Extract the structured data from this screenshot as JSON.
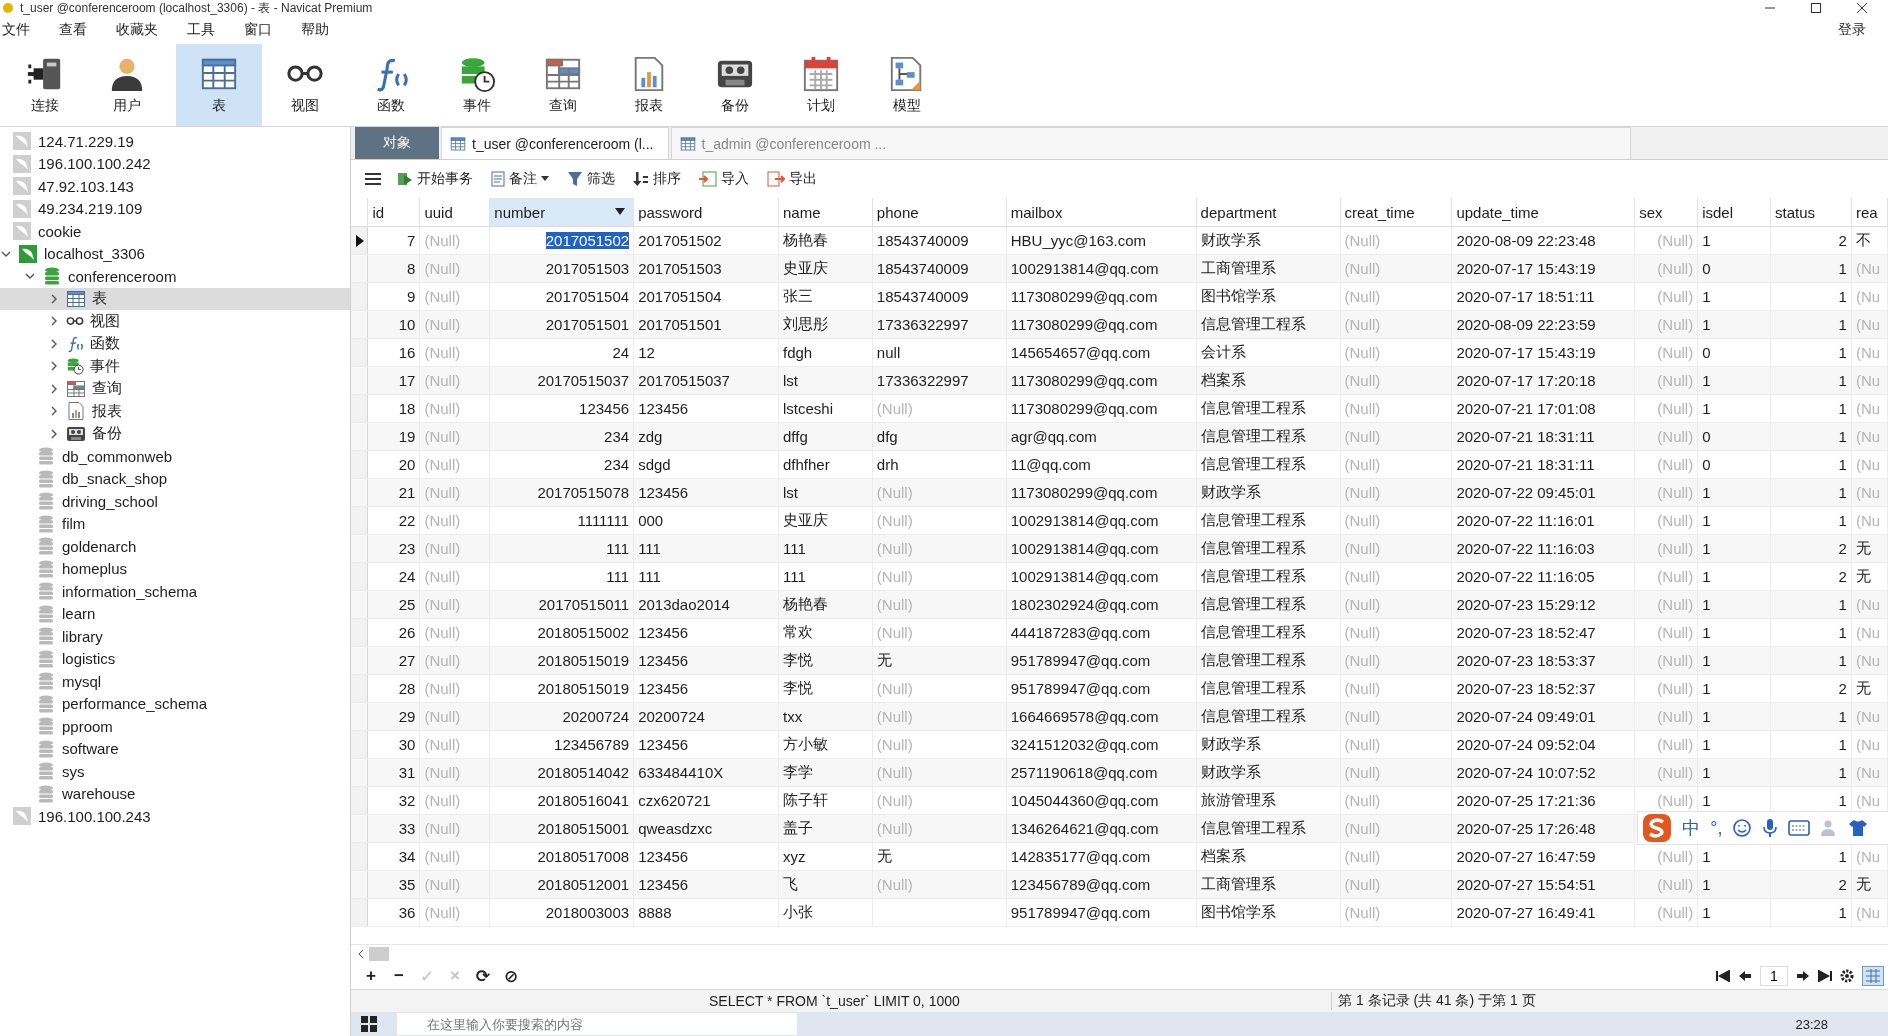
{
  "window": {
    "title": "t_user @conferenceroom (localhost_3306) - 表 - Navicat Premium"
  },
  "menu": [
    "文件",
    "查看",
    "收藏夹",
    "工具",
    "窗口",
    "帮助"
  ],
  "login": "登录",
  "toolbar": [
    {
      "label": "连接",
      "kind": "connection",
      "selected": false
    },
    {
      "label": "用户",
      "kind": "user",
      "selected": false
    },
    {
      "label": "表",
      "kind": "tables",
      "selected": true
    },
    {
      "label": "视图",
      "kind": "views",
      "selected": false
    },
    {
      "label": "函数",
      "kind": "functions",
      "selected": false
    },
    {
      "label": "事件",
      "kind": "events",
      "selected": false
    },
    {
      "label": "查询",
      "kind": "queries",
      "selected": false
    },
    {
      "label": "报表",
      "kind": "reports",
      "selected": false
    },
    {
      "label": "备份",
      "kind": "backups",
      "selected": false
    },
    {
      "label": "计划",
      "kind": "schedule",
      "selected": false
    },
    {
      "label": "模型",
      "kind": "model",
      "selected": false
    }
  ],
  "sidebar": {
    "tree": [
      {
        "label": "124.71.229.19",
        "kind": "connection",
        "active": false
      },
      {
        "label": "196.100.100.242",
        "kind": "connection",
        "active": false
      },
      {
        "label": "47.92.103.143",
        "kind": "connection",
        "active": false
      },
      {
        "label": "49.234.219.109",
        "kind": "connection",
        "active": false
      },
      {
        "label": "cookie",
        "kind": "connection",
        "active": false
      },
      {
        "label": "localhost_3306",
        "kind": "connection",
        "active": true,
        "expanded": true,
        "children": [
          {
            "label": "conferenceroom",
            "kind": "database",
            "active": true,
            "expanded": true,
            "children": [
              {
                "label": "表",
                "kind": "tables",
                "selected": true,
                "expanded": false
              },
              {
                "label": "视图",
                "kind": "views",
                "selected": false,
                "expanded": false
              },
              {
                "label": "函数",
                "kind": "functions",
                "selected": false,
                "expanded": false
              },
              {
                "label": "事件",
                "kind": "events",
                "selected": false,
                "expanded": false
              },
              {
                "label": "查询",
                "kind": "queries",
                "selected": false,
                "expanded": false
              },
              {
                "label": "报表",
                "kind": "reports",
                "selected": false,
                "expanded": false
              },
              {
                "label": "备份",
                "kind": "backups",
                "selected": false,
                "expanded": false
              }
            ]
          },
          {
            "label": "db_commonweb",
            "kind": "database",
            "active": false
          },
          {
            "label": "db_snack_shop",
            "kind": "database",
            "active": false
          },
          {
            "label": "driving_school",
            "kind": "database",
            "active": false
          },
          {
            "label": "film",
            "kind": "database",
            "active": false
          },
          {
            "label": "goldenarch",
            "kind": "database",
            "active": false
          },
          {
            "label": "homeplus",
            "kind": "database",
            "active": false
          },
          {
            "label": "information_schema",
            "kind": "database",
            "active": false
          },
          {
            "label": "learn",
            "kind": "database",
            "active": false
          },
          {
            "label": "library",
            "kind": "database",
            "active": false
          },
          {
            "label": "logistics",
            "kind": "database",
            "active": false
          },
          {
            "label": "mysql",
            "kind": "database",
            "active": false
          },
          {
            "label": "performance_schema",
            "kind": "database",
            "active": false
          },
          {
            "label": "pproom",
            "kind": "database",
            "active": false
          },
          {
            "label": "software",
            "kind": "database",
            "active": false
          },
          {
            "label": "sys",
            "kind": "database",
            "active": false
          },
          {
            "label": "warehouse",
            "kind": "database",
            "active": false
          }
        ]
      },
      {
        "label": "196.100.100.243",
        "kind": "connection",
        "active": false
      }
    ]
  },
  "tabs": [
    {
      "label": "对象",
      "kind": "objects",
      "selected": false
    },
    {
      "label": "t_user @conferenceroom (l...",
      "kind": "table",
      "selected": true
    },
    {
      "label": "t_admin @conferenceroom ...",
      "kind": "table",
      "selected": false
    }
  ],
  "actions": [
    {
      "label": "开始事务",
      "kind": "transaction"
    },
    {
      "label": "备注",
      "kind": "memo"
    },
    {
      "label": "筛选",
      "kind": "filter"
    },
    {
      "label": "排序",
      "kind": "sort"
    },
    {
      "label": "导入",
      "kind": "import"
    },
    {
      "label": "导出",
      "kind": "export"
    }
  ],
  "table": {
    "columns": [
      {
        "name": "id",
        "kind": "number",
        "selected": false
      },
      {
        "name": "uuid",
        "kind": "text",
        "selected": false
      },
      {
        "name": "number",
        "kind": "number",
        "selected": true
      },
      {
        "name": "password",
        "kind": "text",
        "selected": false
      },
      {
        "name": "name",
        "kind": "text",
        "selected": false
      },
      {
        "name": "phone",
        "kind": "text",
        "selected": false
      },
      {
        "name": "mailbox",
        "kind": "text",
        "selected": false
      },
      {
        "name": "department",
        "kind": "text",
        "selected": false
      },
      {
        "name": "creat_time",
        "kind": "text",
        "selected": false
      },
      {
        "name": "update_time",
        "kind": "text",
        "selected": false
      },
      {
        "name": "sex",
        "kind": "number",
        "selected": false
      },
      {
        "name": "isdel",
        "kind": "text",
        "selected": false
      },
      {
        "name": "status",
        "kind": "number",
        "selected": false
      },
      {
        "name": "rea",
        "kind": "text",
        "selected": false
      }
    ],
    "rows": [
      {
        "current": true,
        "cells": [
          "7",
          {
            "null": "(Null)"
          },
          "2017051502",
          "2017051502",
          "杨艳春",
          "18543740009",
          "HBU_yyc@163.com",
          "财政学系",
          {
            "null": "(Null)"
          },
          "2020-08-09 22:23:48",
          {
            "null": "(Null)"
          },
          "1",
          "2",
          "不"
        ]
      },
      {
        "current": false,
        "cells": [
          "8",
          {
            "null": "(Null)"
          },
          "2017051503",
          "2017051503",
          "史亚庆",
          "18543740009",
          "1002913814@qq.com",
          "工商管理系",
          {
            "null": "(Null)"
          },
          "2020-07-17 15:43:19",
          {
            "null": "(Null)"
          },
          "0",
          "1",
          {
            "null": "(Nu"
          }
        ]
      },
      {
        "current": false,
        "cells": [
          "9",
          {
            "null": "(Null)"
          },
          "2017051504",
          "2017051504",
          "张三",
          "18543740009",
          "1173080299@qq.com",
          "图书馆学系",
          {
            "null": "(Null)"
          },
          "2020-07-17 18:51:11",
          {
            "null": "(Null)"
          },
          "1",
          "1",
          {
            "null": "(Nu"
          }
        ]
      },
      {
        "current": false,
        "cells": [
          "10",
          {
            "null": "(Null)"
          },
          "2017051501",
          "2017051501",
          "刘思彤",
          "17336322997",
          "1173080299@qq.com",
          "信息管理工程系",
          {
            "null": "(Null)"
          },
          "2020-08-09 22:23:59",
          {
            "null": "(Null)"
          },
          "1",
          "1",
          {
            "null": "(Nu"
          }
        ]
      },
      {
        "current": false,
        "cells": [
          "16",
          {
            "null": "(Null)"
          },
          "24",
          "12",
          "fdgh",
          "null",
          "145654657@qq.com",
          "会计系",
          {
            "null": "(Null)"
          },
          "2020-07-17 15:43:19",
          {
            "null": "(Null)"
          },
          "0",
          "1",
          {
            "null": "(Nu"
          }
        ]
      },
      {
        "current": false,
        "cells": [
          "17",
          {
            "null": "(Null)"
          },
          "20170515037",
          "20170515037",
          "lst",
          "17336322997",
          "1173080299@qq.com",
          "档案系",
          {
            "null": "(Null)"
          },
          "2020-07-17 17:20:18",
          {
            "null": "(Null)"
          },
          "1",
          "1",
          {
            "null": "(Nu"
          }
        ]
      },
      {
        "current": false,
        "cells": [
          "18",
          {
            "null": "(Null)"
          },
          "123456",
          "123456",
          "lstceshi",
          {
            "null": "(Null)"
          },
          "1173080299@qq.com",
          "信息管理工程系",
          {
            "null": "(Null)"
          },
          "2020-07-21 17:01:08",
          {
            "null": "(Null)"
          },
          "1",
          "1",
          {
            "null": "(Nu"
          }
        ]
      },
      {
        "current": false,
        "cells": [
          "19",
          {
            "null": "(Null)"
          },
          "234",
          "zdg",
          "dffg",
          "dfg",
          "agr@qq.com",
          "信息管理工程系",
          {
            "null": "(Null)"
          },
          "2020-07-21 18:31:11",
          {
            "null": "(Null)"
          },
          "0",
          "1",
          {
            "null": "(Nu"
          }
        ]
      },
      {
        "current": false,
        "cells": [
          "20",
          {
            "null": "(Null)"
          },
          "234",
          "sdgd",
          "dfhfher",
          "drh",
          "11@qq.com",
          "信息管理工程系",
          {
            "null": "(Null)"
          },
          "2020-07-21 18:31:11",
          {
            "null": "(Null)"
          },
          "0",
          "1",
          {
            "null": "(Nu"
          }
        ]
      },
      {
        "current": false,
        "cells": [
          "21",
          {
            "null": "(Null)"
          },
          "20170515078",
          "123456",
          "lst",
          {
            "null": "(Null)"
          },
          "1173080299@qq.com",
          "财政学系",
          {
            "null": "(Null)"
          },
          "2020-07-22 09:45:01",
          {
            "null": "(Null)"
          },
          "1",
          "1",
          {
            "null": "(Nu"
          }
        ]
      },
      {
        "current": false,
        "cells": [
          "22",
          {
            "null": "(Null)"
          },
          "1111111",
          "000",
          "史亚庆",
          {
            "null": "(Null)"
          },
          "1002913814@qq.com",
          "信息管理工程系",
          {
            "null": "(Null)"
          },
          "2020-07-22 11:16:01",
          {
            "null": "(Null)"
          },
          "1",
          "1",
          {
            "null": "(Nu"
          }
        ]
      },
      {
        "current": false,
        "cells": [
          "23",
          {
            "null": "(Null)"
          },
          "111",
          "111",
          "111",
          {
            "null": "(Null)"
          },
          "1002913814@qq.com",
          "信息管理工程系",
          {
            "null": "(Null)"
          },
          "2020-07-22 11:16:03",
          {
            "null": "(Null)"
          },
          "1",
          "2",
          "无"
        ]
      },
      {
        "current": false,
        "cells": [
          "24",
          {
            "null": "(Null)"
          },
          "111",
          "111",
          "111",
          {
            "null": "(Null)"
          },
          "1002913814@qq.com",
          "信息管理工程系",
          {
            "null": "(Null)"
          },
          "2020-07-22 11:16:05",
          {
            "null": "(Null)"
          },
          "1",
          "2",
          "无"
        ]
      },
      {
        "current": false,
        "cells": [
          "25",
          {
            "null": "(Null)"
          },
          "20170515011",
          "2013dao2014",
          "杨艳春",
          {
            "null": "(Null)"
          },
          "1802302924@qq.com",
          "信息管理工程系",
          {
            "null": "(Null)"
          },
          "2020-07-23 15:29:12",
          {
            "null": "(Null)"
          },
          "1",
          "1",
          {
            "null": "(Nu"
          }
        ]
      },
      {
        "current": false,
        "cells": [
          "26",
          {
            "null": "(Null)"
          },
          "20180515002",
          "123456",
          "常欢",
          {
            "null": "(Null)"
          },
          "444187283@qq.com",
          "信息管理工程系",
          {
            "null": "(Null)"
          },
          "2020-07-23 18:52:47",
          {
            "null": "(Null)"
          },
          "1",
          "1",
          {
            "null": "(Nu"
          }
        ]
      },
      {
        "current": false,
        "cells": [
          "27",
          {
            "null": "(Null)"
          },
          "20180515019",
          "123456",
          "李悦",
          "无",
          "951789947@qq.com",
          "信息管理工程系",
          {
            "null": "(Null)"
          },
          "2020-07-23 18:53:37",
          {
            "null": "(Null)"
          },
          "1",
          "1",
          {
            "null": "(Nu"
          }
        ]
      },
      {
        "current": false,
        "cells": [
          "28",
          {
            "null": "(Null)"
          },
          "20180515019",
          "123456",
          "李悦",
          {
            "null": "(Null)"
          },
          "951789947@qq.com",
          "信息管理工程系",
          {
            "null": "(Null)"
          },
          "2020-07-23 18:52:37",
          {
            "null": "(Null)"
          },
          "1",
          "2",
          "无"
        ]
      },
      {
        "current": false,
        "cells": [
          "29",
          {
            "null": "(Null)"
          },
          "20200724",
          "20200724",
          "txx",
          {
            "null": "(Null)"
          },
          "1664669578@qq.com",
          "信息管理工程系",
          {
            "null": "(Null)"
          },
          "2020-07-24 09:49:01",
          {
            "null": "(Null)"
          },
          "1",
          "1",
          {
            "null": "(Nu"
          }
        ]
      },
      {
        "current": false,
        "cells": [
          "30",
          {
            "null": "(Null)"
          },
          "123456789",
          "123456",
          "方小敏",
          {
            "null": "(Null)"
          },
          "3241512032@qq.com",
          "财政学系",
          {
            "null": "(Null)"
          },
          "2020-07-24 09:52:04",
          {
            "null": "(Null)"
          },
          "1",
          "1",
          {
            "null": "(Nu"
          }
        ]
      },
      {
        "current": false,
        "cells": [
          "31",
          {
            "null": "(Null)"
          },
          "20180514042",
          "633484410X",
          "李学",
          {
            "null": "(Null)"
          },
          "2571190618@qq.com",
          "财政学系",
          {
            "null": "(Null)"
          },
          "2020-07-24 10:07:52",
          {
            "null": "(Null)"
          },
          "1",
          "1",
          {
            "null": "(Nu"
          }
        ]
      },
      {
        "current": false,
        "cells": [
          "32",
          {
            "null": "(Null)"
          },
          "20180516041",
          "czx620721",
          "陈子轩",
          {
            "null": "(Null)"
          },
          "1045044360@qq.com",
          "旅游管理系",
          {
            "null": "(Null)"
          },
          "2020-07-25 17:21:36",
          {
            "null": "(Null)"
          },
          "1",
          "1",
          {
            "null": "(Nu"
          }
        ]
      },
      {
        "current": false,
        "cells": [
          "33",
          {
            "null": "(Null)"
          },
          "20180515001",
          "qweasdzxc",
          "盖子",
          {
            "null": "(Null)"
          },
          "1346264621@qq.com",
          "信息管理工程系",
          {
            "null": "(Null)"
          },
          "2020-07-25 17:26:48"
        ]
      },
      {
        "current": false,
        "cells": [
          "34",
          {
            "null": "(Null)"
          },
          "20180517008",
          "123456",
          "xyz",
          "无",
          "142835177@qq.com",
          "档案系",
          {
            "null": "(Null)"
          },
          "2020-07-27 16:47:59",
          {
            "null": "(Null)"
          },
          "1",
          "1",
          {
            "null": "(Nu"
          }
        ]
      },
      {
        "current": false,
        "cells": [
          "35",
          {
            "null": "(Null)"
          },
          "20180512001",
          "123456",
          "飞",
          {
            "null": "(Null)"
          },
          "123456789@qq.com",
          "工商管理系",
          {
            "null": "(Null)"
          },
          "2020-07-27 15:54:51",
          {
            "null": "(Null)"
          },
          "1",
          "2",
          "无"
        ]
      },
      {
        "current": false,
        "cells": [
          "36",
          {
            "null": "(Null)"
          },
          "2018003003",
          "8888",
          "小张",
          null,
          "951789947@qq.com",
          "图书馆学系",
          {
            "null": "(Null)"
          },
          "2020-07-27 16:49:41",
          {
            "null": "(Null)"
          },
          "1",
          "1",
          {
            "null": "(Nu"
          }
        ]
      }
    ]
  },
  "ime_toolbar": {
    "mode": "中",
    "punctuation": "°,"
  },
  "record_buttons": [
    {
      "symbol": "+",
      "disabled": false
    },
    {
      "symbol": "−",
      "disabled": false
    },
    {
      "symbol": "✓",
      "disabled": true
    },
    {
      "symbol": "×",
      "disabled": true
    },
    {
      "symbol": "⟳",
      "disabled": false
    },
    {
      "symbol": "⊘",
      "disabled": false
    }
  ],
  "pager": {
    "page": "1"
  },
  "status_bar": {
    "sql": "SELECT * FROM `t_user` LIMIT 0, 1000",
    "record": "第 1 条记录 (共 41 条) 于第 1 页"
  },
  "taskbar": {
    "search": {
      "placeholder": "在这里输入你要搜索的内容"
    },
    "clock": "23:28"
  }
}
